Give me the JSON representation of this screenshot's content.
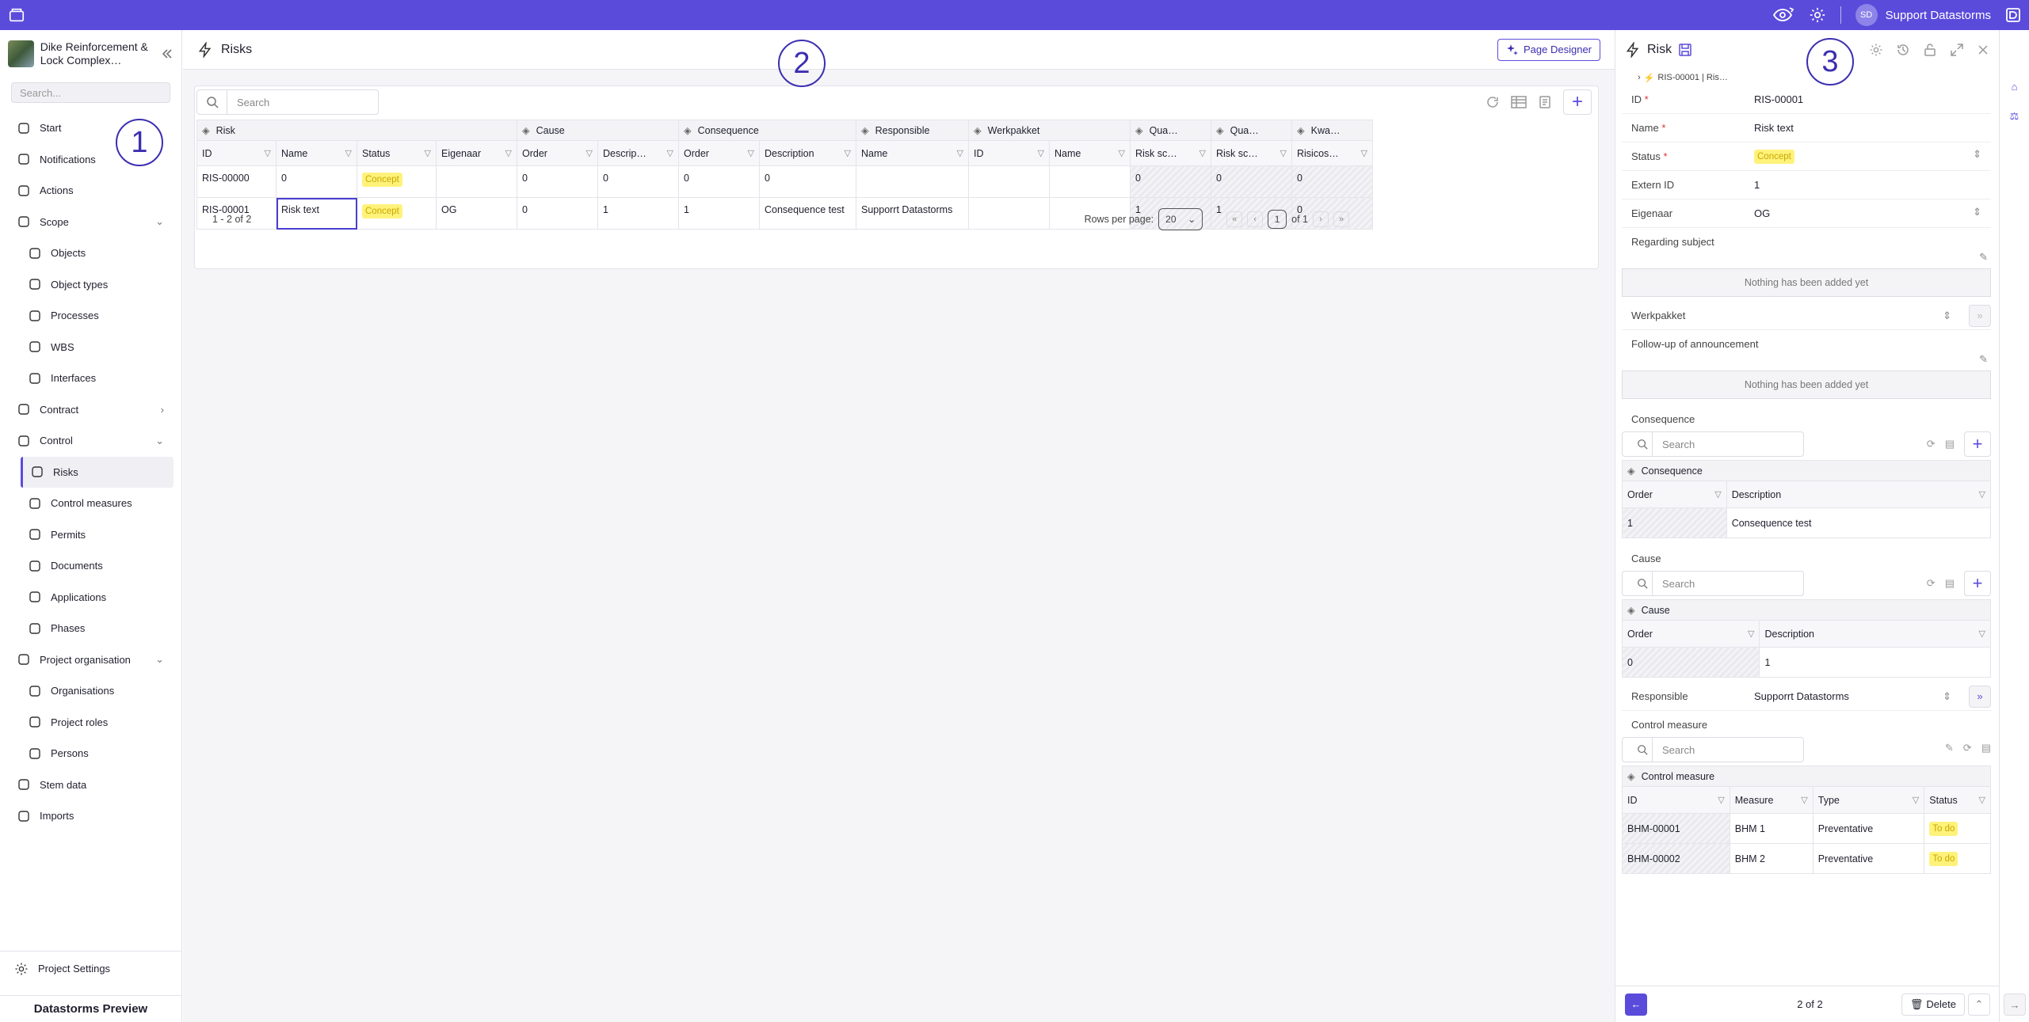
{
  "topbar": {
    "user_initials": "SD",
    "user_name": "Support Datastorms"
  },
  "sidebar": {
    "project_name": "Dike Reinforcement & Lock Complex…",
    "search_placeholder": "Search...",
    "items": [
      {
        "label": "Start",
        "icon": "home-icon",
        "sub": false
      },
      {
        "label": "Notifications",
        "icon": "megaphone-icon",
        "sub": false
      },
      {
        "label": "Actions",
        "icon": "play-circle-icon",
        "sub": false
      },
      {
        "label": "Scope",
        "icon": "tools-icon",
        "sub": false,
        "chev": "down"
      },
      {
        "label": "Objects",
        "icon": "cube-icon",
        "sub": true
      },
      {
        "label": "Object types",
        "icon": "dashed-cube-icon",
        "sub": true
      },
      {
        "label": "Processes",
        "icon": "redo-arrow-icon",
        "sub": true
      },
      {
        "label": "WBS",
        "icon": "folder-icon",
        "sub": true
      },
      {
        "label": "Interfaces",
        "icon": "interfaces-icon",
        "sub": true
      },
      {
        "label": "Contract",
        "icon": "alert-circle-icon",
        "sub": false,
        "chev": "right"
      },
      {
        "label": "Control",
        "icon": "chart-icon",
        "sub": false,
        "chev": "down"
      },
      {
        "label": "Risks",
        "icon": "lightning-icon",
        "sub": true,
        "active": true
      },
      {
        "label": "Control measures",
        "icon": "gear-icon",
        "sub": true
      },
      {
        "label": "Permits",
        "icon": "permit-icon",
        "sub": true
      },
      {
        "label": "Documents",
        "icon": "document-icon",
        "sub": true
      },
      {
        "label": "Applications",
        "icon": "sign-in-icon",
        "sub": true
      },
      {
        "label": "Phases",
        "icon": "calendar-icon",
        "sub": true
      },
      {
        "label": "Project organisation",
        "icon": "people-icon",
        "sub": false,
        "chev": "down"
      },
      {
        "label": "Organisations",
        "icon": "building-icon",
        "sub": true
      },
      {
        "label": "Project roles",
        "icon": "role-icon",
        "sub": true
      },
      {
        "label": "Persons",
        "icon": "person-icon",
        "sub": true
      },
      {
        "label": "Stem data",
        "icon": "tools-icon",
        "sub": false
      },
      {
        "label": "Imports",
        "icon": "download-icon",
        "sub": false
      }
    ],
    "settings_label": "Project Settings",
    "footer": "Datastorms Preview"
  },
  "main": {
    "title": "Risks",
    "page_designer": "Page Designer",
    "search_placeholder": "Search",
    "groups": [
      {
        "label": "Risk",
        "span": 4,
        "icon": "lightning-icon"
      },
      {
        "label": "Cause",
        "span": 2,
        "icon": "cause-icon"
      },
      {
        "label": "Consequence",
        "span": 2,
        "icon": "consequence-icon"
      },
      {
        "label": "Responsible",
        "span": 1,
        "icon": "fingerprint-icon"
      },
      {
        "label": "Werkpakket",
        "span": 2,
        "icon": "folder-icon"
      },
      {
        "label": "Qua…",
        "span": 1,
        "icon": "scale-icon"
      },
      {
        "label": "Qua…",
        "span": 1,
        "icon": "scale-icon"
      },
      {
        "label": "Kwa…",
        "span": 1,
        "icon": "scale-icon"
      }
    ],
    "columns": [
      "ID",
      "Name",
      "Status",
      "Eigenaar",
      "Order",
      "Descrip…",
      "Order",
      "Description",
      "Name",
      "ID",
      "Name",
      "Risk sc…",
      "Risk sc…",
      "Risicos…"
    ],
    "col_widths": [
      100,
      102,
      100,
      102,
      102,
      102,
      102,
      122,
      142,
      102,
      102,
      102,
      102,
      102
    ],
    "rows": [
      [
        "RIS-00000",
        "0",
        "Concept",
        "",
        "0",
        "0",
        "0",
        "0",
        "",
        "",
        "",
        "0",
        "0",
        "0"
      ],
      [
        "RIS-00001",
        "Risk text",
        "Concept",
        "OG",
        "0",
        "1",
        "1",
        "Consequence test",
        "Supporrt Datastorms",
        "",
        "",
        "1",
        "1",
        "0"
      ]
    ],
    "count": "1 - 2 of 2",
    "rows_per_page_label": "Rows per page:",
    "rows_per_page": "20",
    "page": "1",
    "of_pages": "of 1"
  },
  "panel": {
    "title": "Risk",
    "breadcrumb": "RIS-00001 | Ris…",
    "fields": [
      {
        "label": "ID",
        "req": true,
        "value": "RIS-00001",
        "select": false
      },
      {
        "label": "Name",
        "req": true,
        "value": "Risk text",
        "select": false
      },
      {
        "label": "Status",
        "req": true,
        "value": "Concept",
        "select": true,
        "badge": true
      },
      {
        "label": "Extern ID",
        "req": false,
        "value": "1",
        "select": false
      },
      {
        "label": "Eigenaar",
        "req": false,
        "value": "OG",
        "select": true
      }
    ],
    "regarding_label": "Regarding subject",
    "empty_text": "Nothing has been added yet",
    "werkpakket_label": "Werkpakket",
    "followup_label": "Follow-up of announcement",
    "consequence_label": "Consequence",
    "cause_label": "Cause",
    "search_placeholder": "Search",
    "cons_grid": {
      "group": "Consequence",
      "cols": [
        "Order",
        "Description"
      ],
      "row": [
        "1",
        "Consequence test"
      ]
    },
    "cause_grid": {
      "group": "Cause",
      "cols": [
        "Order",
        "Description"
      ],
      "row": [
        "0",
        "1"
      ]
    },
    "responsible_label": "Responsible",
    "responsible_value": "Supporrt Datastorms",
    "cm_label": "Control measure",
    "cm_grid": {
      "group": "Control measure",
      "cols": [
        "ID",
        "Measure",
        "Type",
        "Status"
      ],
      "rows": [
        [
          "BHM-00001",
          "BHM 1",
          "Preventative",
          "To do"
        ],
        [
          "BHM-00002",
          "BHM 2",
          "Preventative",
          "To do"
        ]
      ]
    },
    "nav_count": "2 of 2",
    "delete_label": "Delete"
  },
  "annotations": [
    "1",
    "2",
    "3"
  ],
  "colors": {
    "accent": "#5b4bdb",
    "badge_bg": "#fff27a",
    "badge_text": "#c8a800"
  }
}
